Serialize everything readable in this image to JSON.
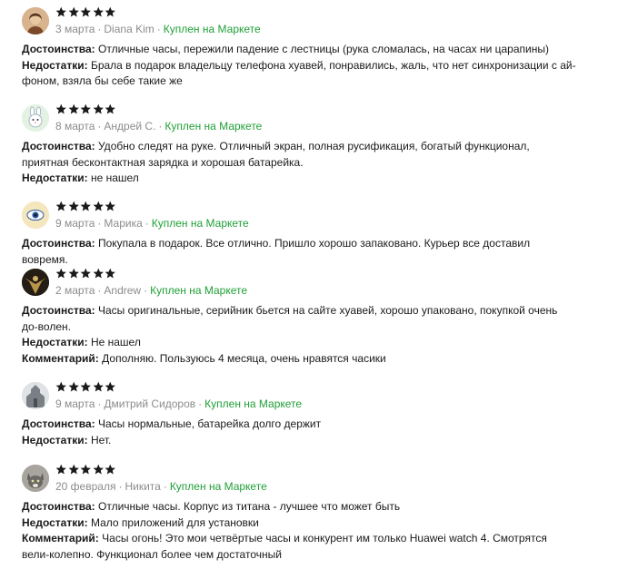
{
  "colors": {
    "star": "#1a1a1a",
    "bought_label": "#21a038",
    "meta": "#8c8c8c"
  },
  "labels": {
    "pros": "Достоинства:",
    "cons": "Недостатки:",
    "comment": "Комментарий:",
    "bought": "Куплен на Маркете"
  },
  "reviews": [
    {
      "rating": 5,
      "date": "3 марта",
      "author": "Diana Kim",
      "avatar": "photo-woman-avatar",
      "pros": "Отличные часы, пережили падение с лестницы (рука сломалась, на часах ни царапины)",
      "cons": "Брала в подарок владельцу телефона хуавей, понравились, жаль, что нет синхронизации с ай-фоном, взяла бы себе такие же"
    },
    {
      "rating": 5,
      "date": "8 марта",
      "author": "Андрей С.",
      "avatar": "bunny-avatar",
      "pros": "Удобно следят на руке. Отличный экран, полная русификация, богатый функционал, приятная бесконтактная зарядка и хорошая батарейка.",
      "cons": "не нашел"
    },
    {
      "rating": 5,
      "date": "9 марта",
      "author": "Марика",
      "avatar": "eye-avatar",
      "pros": "Покупала в подарок. Все отлично. Пришло хорошо запаковано. Курьер все доставил вовремя."
    },
    {
      "rating": 5,
      "date": "2 марта",
      "author": "Andrew",
      "avatar": "dark-figure-avatar",
      "pros": "Часы оригинальные, серийник бьется на сайте хуавей, хорошо упаковано, покупкой очень до-волен.",
      "cons": "Не нашел",
      "comment": "Дополняю. Пользуюсь 4 месяца, очень нравятся часики"
    },
    {
      "rating": 5,
      "date": "9 марта",
      "author": "Дмитрий Сидоров",
      "avatar": "building-avatar",
      "pros": "Часы нормальные, батарейка долго держит",
      "cons": "Нет."
    },
    {
      "rating": 5,
      "date": "20 февраля",
      "author": "Никита",
      "avatar": "cat-avatar",
      "pros": "Отличные часы. Корпус из титана - лучшее что может быть",
      "cons": "Мало приложений для установки",
      "comment": "Часы огонь! Это мои четвёртые часы и конкурент им только Huawei watch 4. Смотрятся вели-колепно. Функционал более чем достаточный"
    }
  ]
}
